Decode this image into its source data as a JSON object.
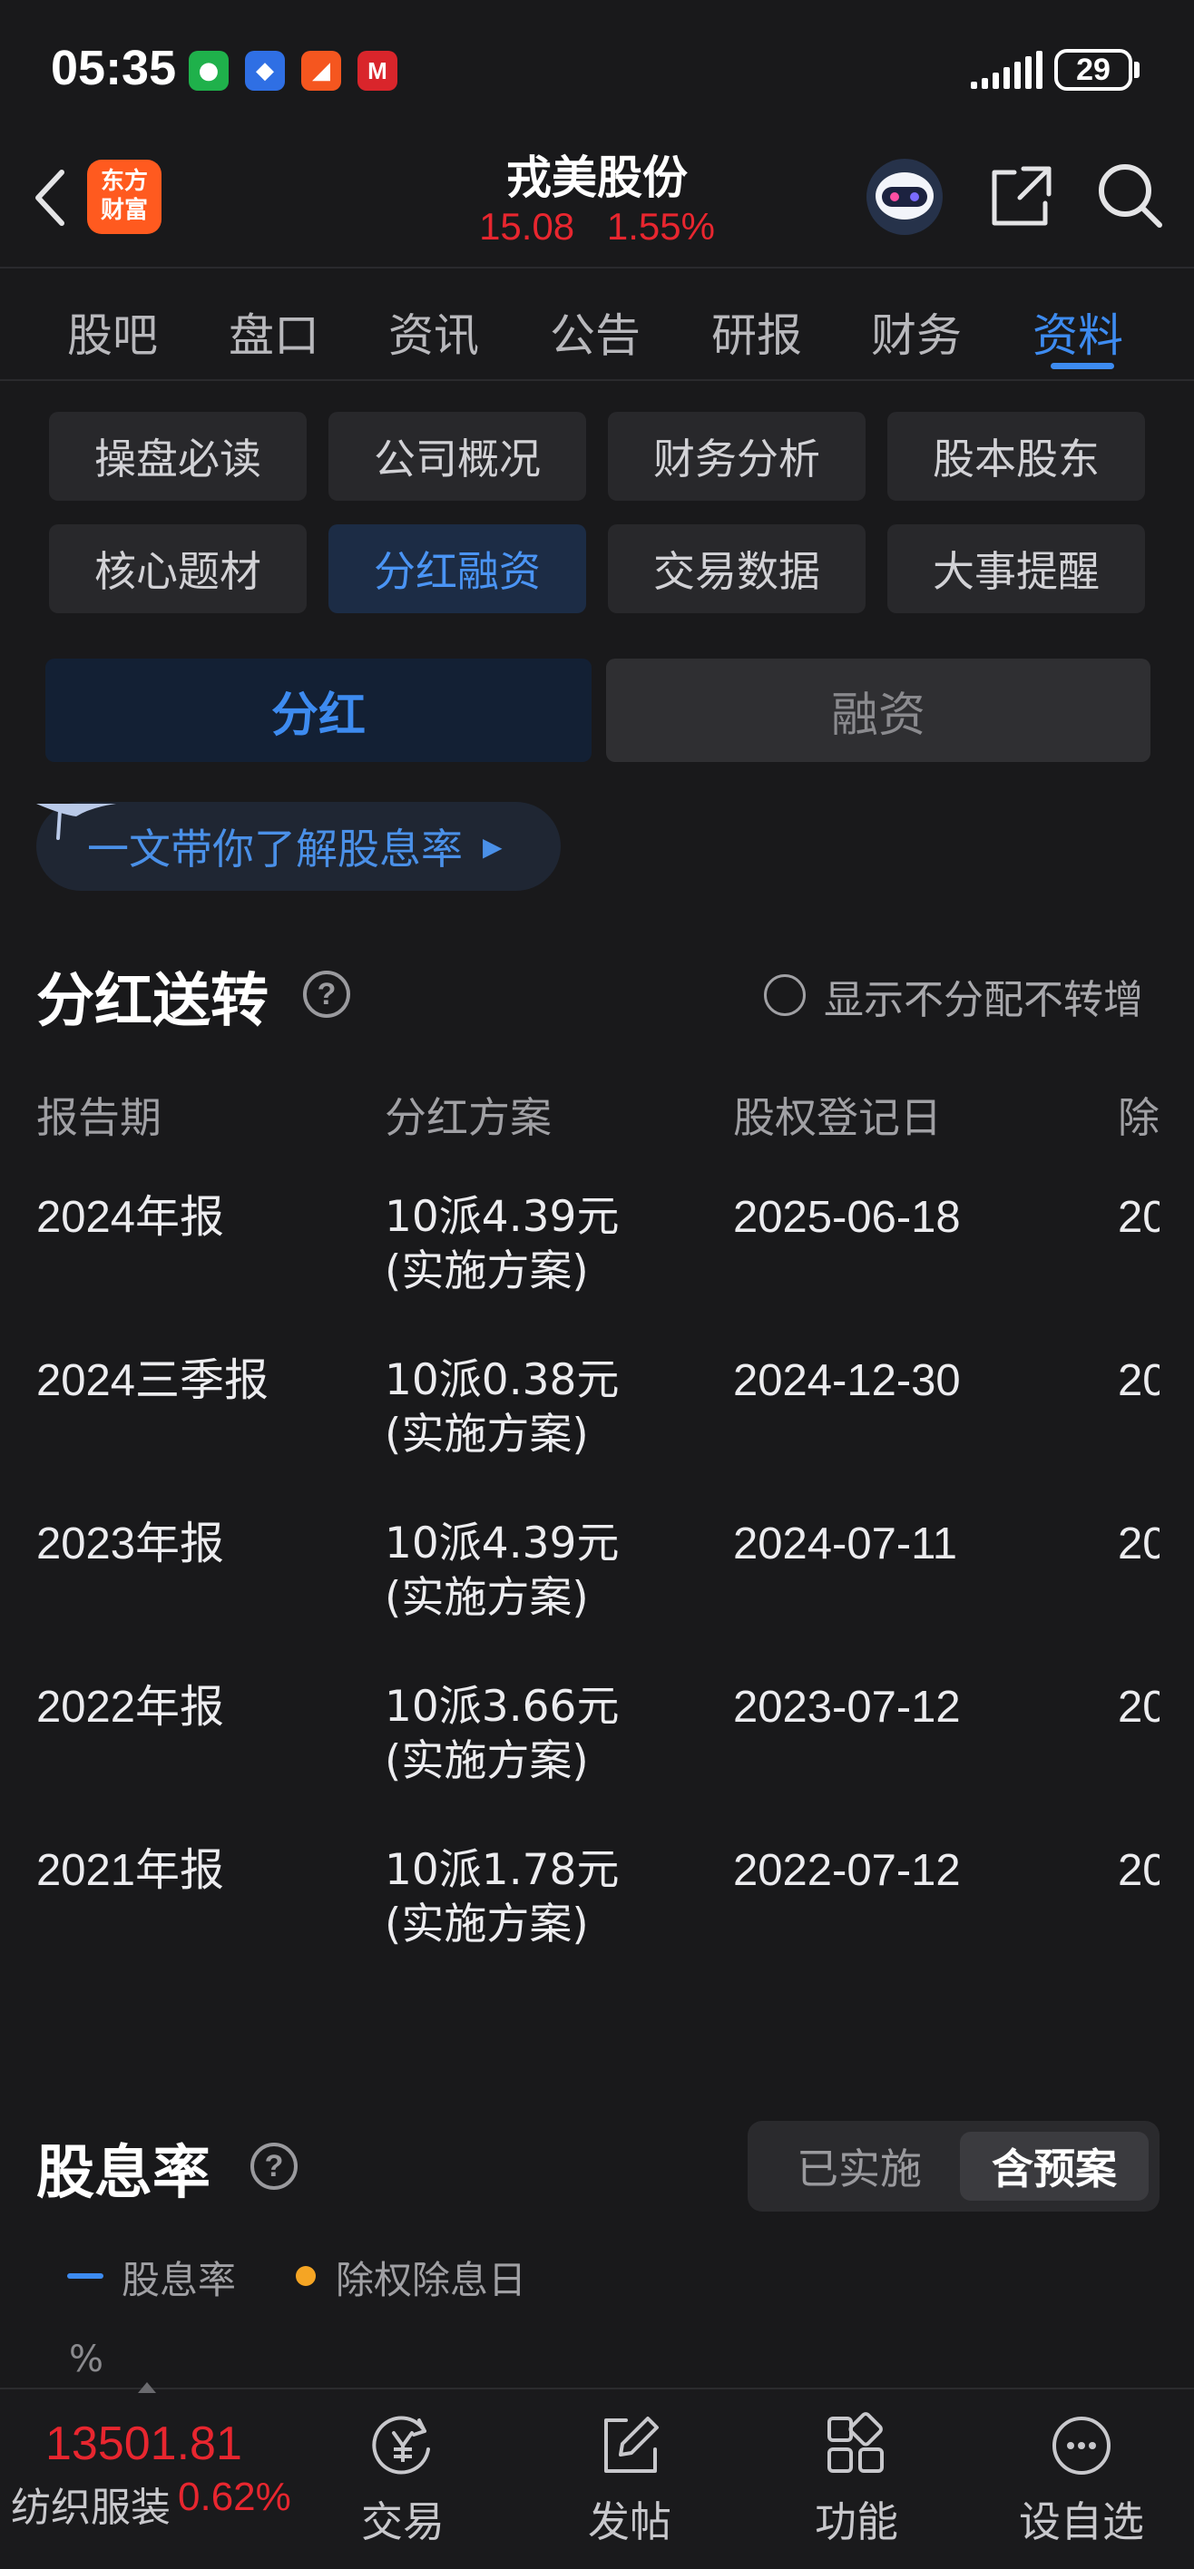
{
  "status_bar": {
    "time": "05:35",
    "apps": [
      {
        "icon": "wechat-icon",
        "color": "#1fb14b",
        "glyph": "●"
      },
      {
        "icon": "app-blue-icon",
        "color": "#2f6fe4",
        "glyph": "◆"
      },
      {
        "icon": "app-orange-icon",
        "color": "#f5561f",
        "glyph": "◢"
      },
      {
        "icon": "cmb-bank-icon",
        "color": "#d9252b",
        "glyph": "M"
      }
    ],
    "battery": "29"
  },
  "header": {
    "logo_text_line1": "东方",
    "logo_text_line2": "财富",
    "stock_name": "戎美股份",
    "price": "15.08",
    "change_pct": "1.55%"
  },
  "main_tabs": [
    {
      "label": "股吧"
    },
    {
      "label": "盘口"
    },
    {
      "label": "资讯"
    },
    {
      "label": "公告"
    },
    {
      "label": "研报"
    },
    {
      "label": "财务"
    },
    {
      "label": "资料",
      "active": true
    }
  ],
  "sub_nav": [
    {
      "label": "操盘必读"
    },
    {
      "label": "公司概况"
    },
    {
      "label": "财务分析"
    },
    {
      "label": "股本股东"
    },
    {
      "label": "核心题材"
    },
    {
      "label": "分红融资",
      "active": true
    },
    {
      "label": "交易数据"
    },
    {
      "label": "大事提醒"
    }
  ],
  "segment": {
    "left": "分红",
    "right": "融资"
  },
  "banner": {
    "text": "一文带你了解股息率"
  },
  "dividend_section": {
    "title": "分红送转",
    "filter_label": "显示不分配不转增",
    "columns": [
      "报告期",
      "分红方案",
      "股权登记日",
      "除"
    ],
    "rows": [
      {
        "period": "2024年报",
        "plan": "10派4.39元",
        "plan_status": "(实施方案)",
        "record_date": "2025-06-18",
        "ex_date_partial": "20"
      },
      {
        "period": "2024三季报",
        "plan": "10派0.38元",
        "plan_status": "(实施方案)",
        "record_date": "2024-12-30",
        "ex_date_partial": "20"
      },
      {
        "period": "2023年报",
        "plan": "10派4.39元",
        "plan_status": "(实施方案)",
        "record_date": "2024-07-11",
        "ex_date_partial": "20"
      },
      {
        "period": "2022年报",
        "plan": "10派3.66元",
        "plan_status": "(实施方案)",
        "record_date": "2023-07-12",
        "ex_date_partial": "20"
      },
      {
        "period": "2021年报",
        "plan": "10派1.78元",
        "plan_status": "(实施方案)",
        "record_date": "2022-07-12",
        "ex_date_partial": "20"
      }
    ]
  },
  "yield_section": {
    "title": "股息率",
    "toggle_off": "已实施",
    "toggle_on": "含预案",
    "legend_line": "股息率",
    "legend_dot": "除权除息日",
    "unit": "%"
  },
  "bottom_bar": {
    "index_value": "13501.81",
    "index_name": "纺织服装",
    "index_change": "0.62%",
    "nav": [
      {
        "label": "交易",
        "icon": "trade-yen-icon"
      },
      {
        "label": "发帖",
        "icon": "compose-icon"
      },
      {
        "label": "功能",
        "icon": "grid-icon"
      },
      {
        "label": "设自选",
        "icon": "more-dots-icon"
      }
    ]
  },
  "colors": {
    "accent": "#3d8bf0",
    "up_red": "#e8262f",
    "background": "#19191b"
  }
}
